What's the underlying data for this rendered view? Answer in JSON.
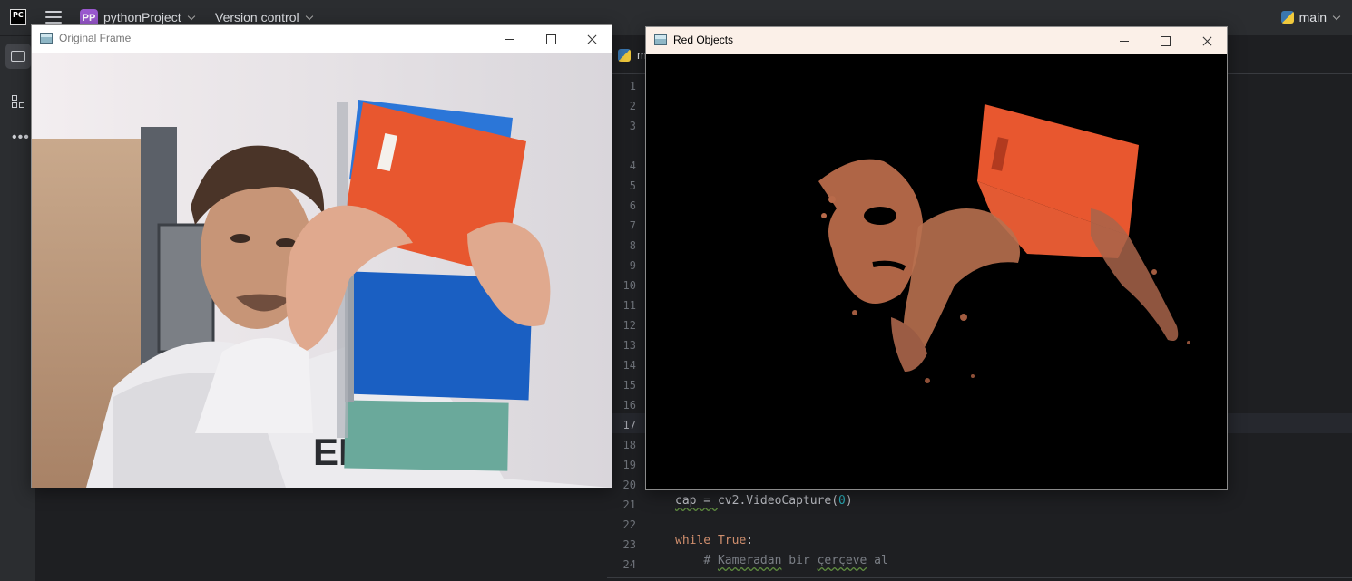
{
  "ide": {
    "logo_text": "PC",
    "project_badge": "PP",
    "project_name": "pythonProject",
    "version_control": "Version control",
    "branch": "main"
  },
  "tool_strip": {
    "items": [
      "project-folder-icon",
      "structure-icon",
      "more-icon"
    ]
  },
  "editor": {
    "tab_label": "m",
    "current_line": "17",
    "line_numbers": [
      "1",
      "2",
      "3",
      "4",
      "5",
      "6",
      "7",
      "8",
      "9",
      "10",
      "11",
      "12",
      "13",
      "14",
      "15",
      "16",
      "17",
      "18",
      "19",
      "20",
      "21",
      "22",
      "23",
      "24"
    ],
    "code": {
      "line21": {
        "a": "cap = ",
        "b": "cv2",
        "c": ".VideoCapture(",
        "d": "0",
        "e": ")"
      },
      "line23": {
        "kw1": "while",
        "kw2": "True",
        "rest": ":"
      },
      "line24": {
        "indent": "    ",
        "hash": "# ",
        "w1": "Kameradan",
        "w2": " bir ",
        "w3": "çerçeve",
        "w4": " al"
      }
    }
  },
  "windows": {
    "original": {
      "title": "Original Frame"
    },
    "red": {
      "title": "Red Objects"
    }
  },
  "colors": {
    "ide_bg": "#1e1f22",
    "ide_panel": "#2b2d30",
    "keyword": "#cf8e6d",
    "number": "#2aacb8",
    "notebook_orange": "#e8572f",
    "notebook_blue": "#1a5fc2",
    "notebook_teal": "#6aa99b",
    "skin_masked": "#b86a4a"
  }
}
